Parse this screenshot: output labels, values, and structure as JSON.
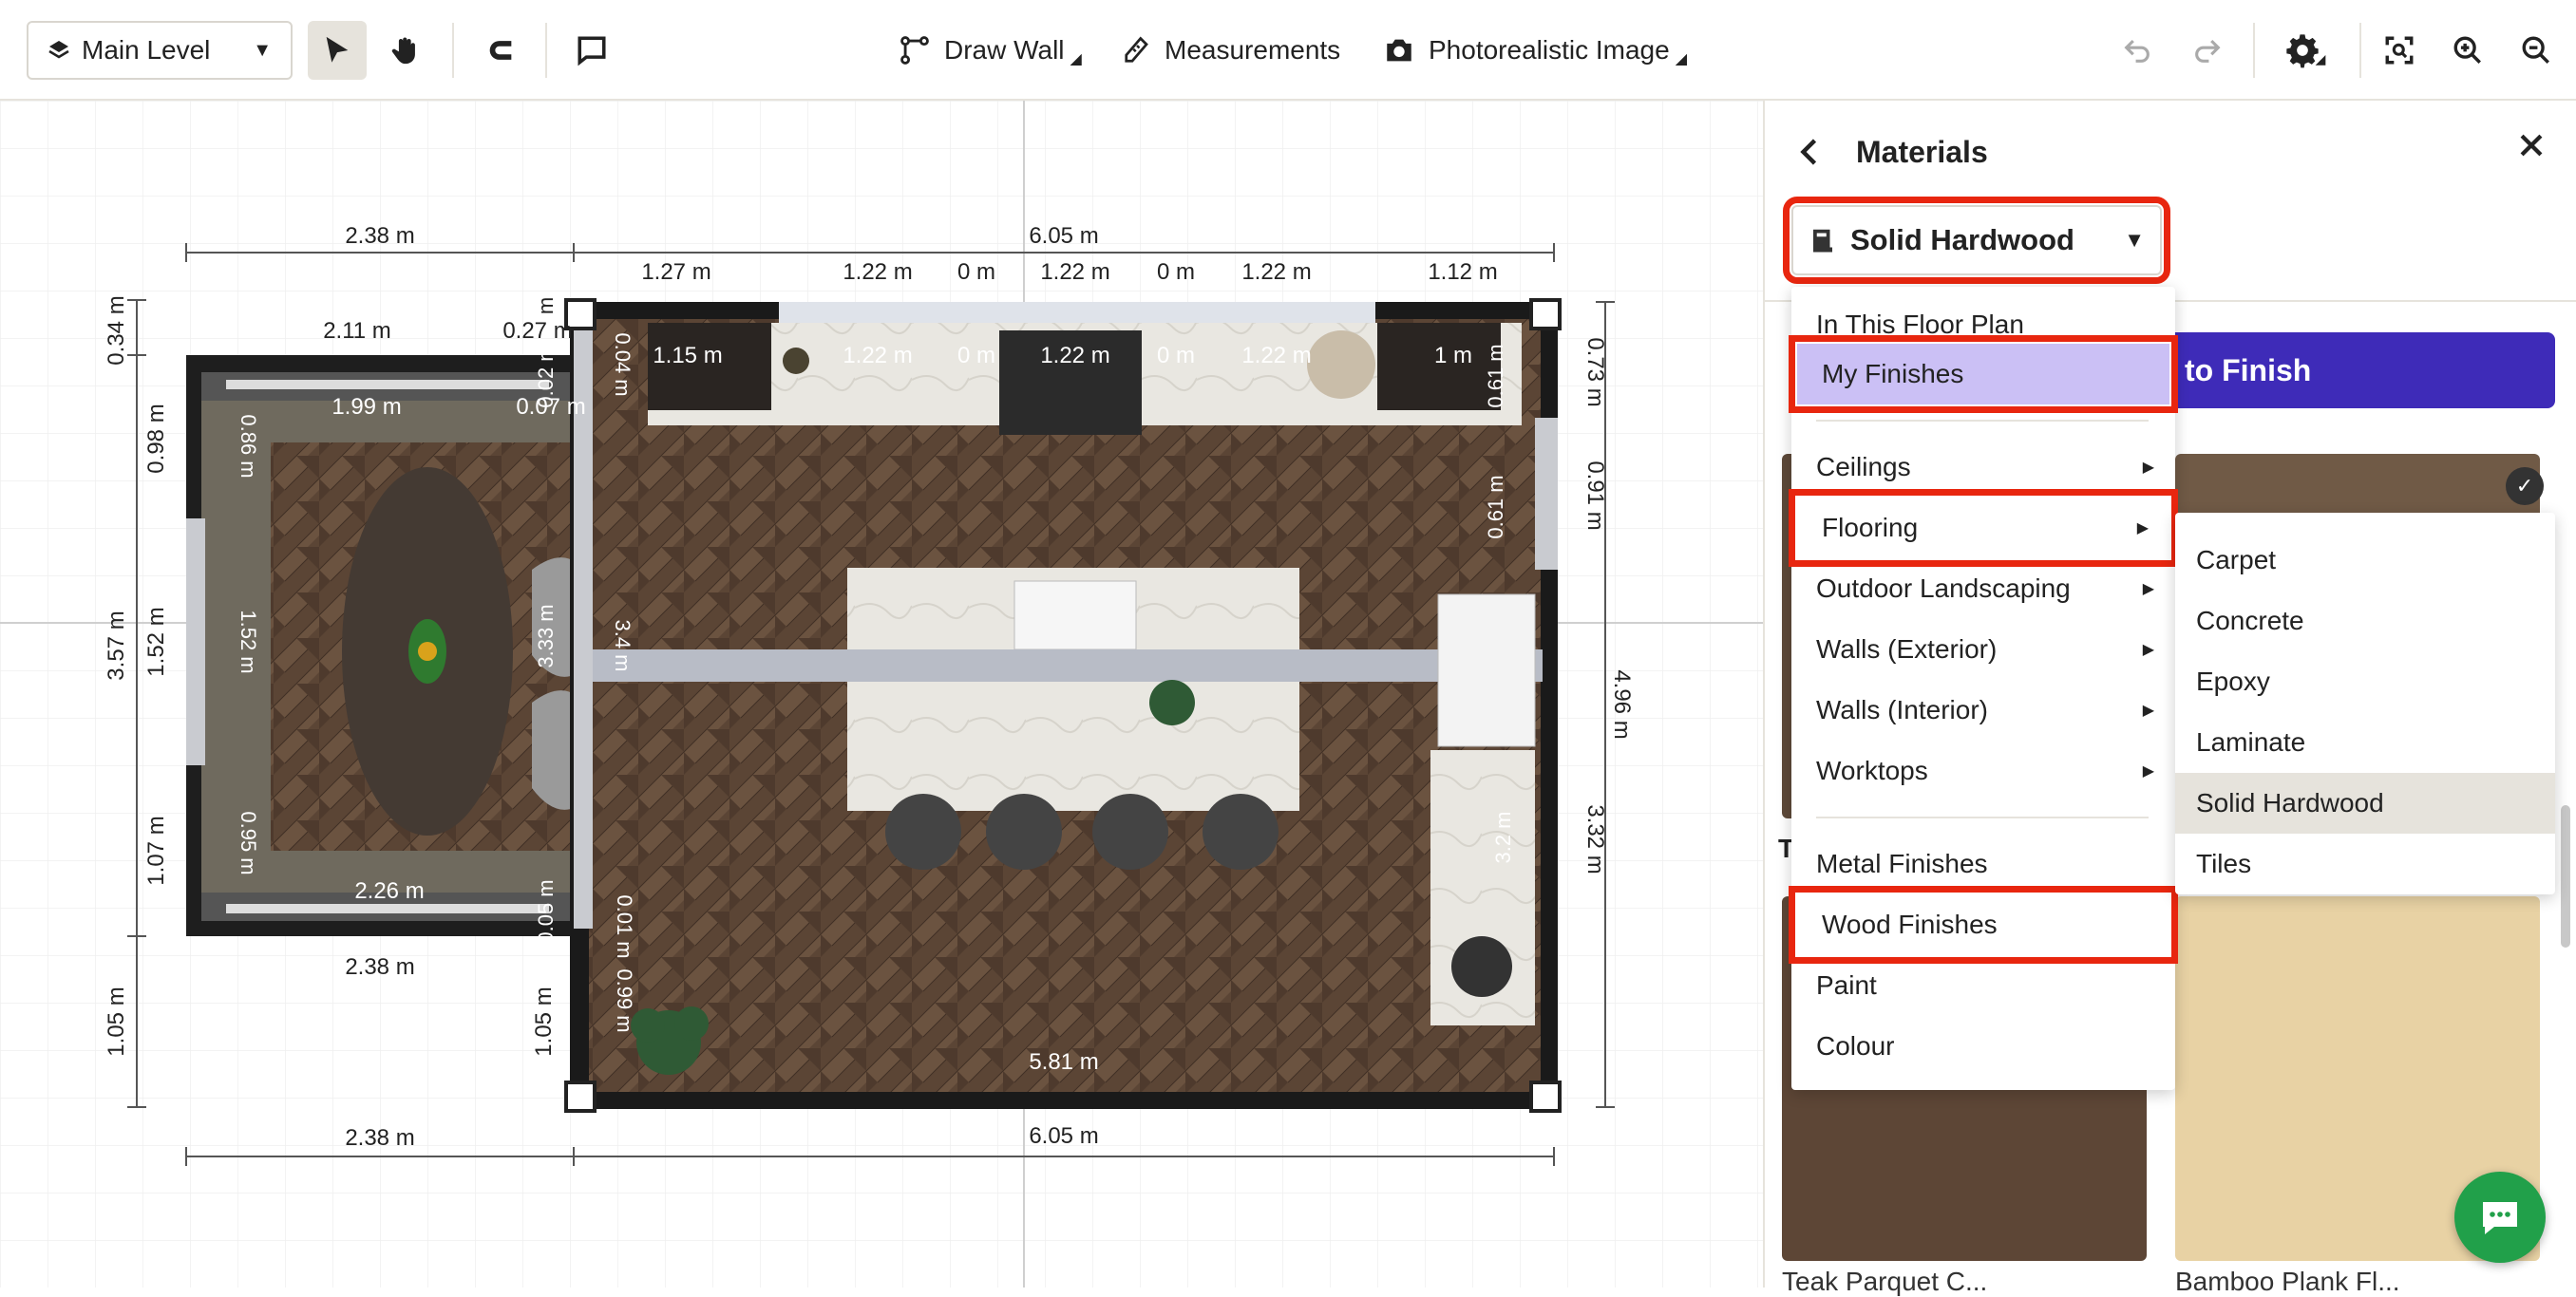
{
  "toolbar": {
    "level": "Main Level",
    "draw_wall": "Draw Wall",
    "measurements": "Measurements",
    "photoreal": "Photorealistic Image"
  },
  "panel": {
    "title": "Materials",
    "category": "Solid Hardwood",
    "apply_button": "to Finish",
    "section_partial": "T",
    "tile_caption_3": "Teak Parquet C...",
    "tile_caption_4": "Bamboo Plank Fl..."
  },
  "menu": {
    "items": [
      {
        "label": "In This Floor Plan"
      },
      {
        "label": "My Finishes"
      },
      {
        "label": "Ceilings"
      },
      {
        "label": "Flooring"
      },
      {
        "label": "Outdoor Landscaping"
      },
      {
        "label": "Walls (Exterior)"
      },
      {
        "label": "Walls (Interior)"
      },
      {
        "label": "Worktops"
      },
      {
        "label": "Metal Finishes"
      },
      {
        "label": "Wood Finishes"
      },
      {
        "label": "Paint"
      },
      {
        "label": "Colour"
      }
    ]
  },
  "submenu": {
    "items": [
      {
        "label": "Carpet"
      },
      {
        "label": "Concrete"
      },
      {
        "label": "Epoxy"
      },
      {
        "label": "Laminate"
      },
      {
        "label": "Solid Hardwood"
      },
      {
        "label": "Tiles"
      }
    ]
  },
  "plan": {
    "dims": {
      "top_left": "2.38 m",
      "top_total": "6.05 m",
      "seg_127": "1.27 m",
      "seg_122": "1.22 m",
      "seg_0": "0 m",
      "seg_112": "1.12 m",
      "dining_211": "2.11 m",
      "d027": "0.27 m",
      "d199": "1.99 m",
      "d007": "0.07 m",
      "d034": "0.34 m",
      "d098": "0.98 m",
      "d357": "3.57 m",
      "d152": "1.52 m",
      "d107": "1.07 m",
      "d105": "1.05 m",
      "d086": "0.86 m",
      "d095": "0.95 m",
      "d226": "2.26 m",
      "bottom_238": "2.38 m",
      "bottom_605": "6.05 m",
      "d115": "1.15 m",
      "d1m": "1 m",
      "d073": "0.73 m",
      "d091": "0.91 m",
      "d061": "0.61 m",
      "d496": "4.96 m",
      "d332": "3.32 m",
      "d581": "5.81 m",
      "d333": "3.33 m",
      "d34": "3.4 m",
      "d32": "3.2 m",
      "d001": "0.01 m",
      "d099": "0.99 m",
      "d005": "0.05 m",
      "d002": "0.02 m",
      "d004": "0.04 m",
      "dm": "m"
    }
  }
}
